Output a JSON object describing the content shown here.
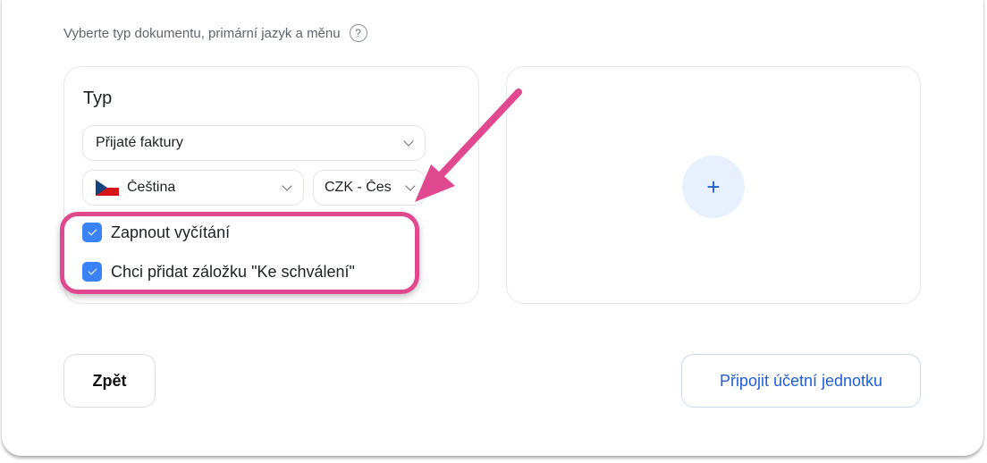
{
  "subtitle": "Vyberte typ dokumentu, primární jazyk a měnu",
  "help_icon": "?",
  "left_card": {
    "title": "Typ",
    "document_type": {
      "value": "Přijaté faktury",
      "icon": "chevron-down-icon"
    },
    "language": {
      "value": "Čeština",
      "flag": "czech-flag-icon"
    },
    "currency": {
      "value": "CZK - Čes"
    },
    "checkboxes": [
      {
        "label": "Zapnout vyčítání",
        "checked": true
      },
      {
        "label": "Chci přidat záložku \"Ke schválení\"",
        "checked": true
      }
    ]
  },
  "right_card": {
    "add_label": "+"
  },
  "buttons": {
    "back": "Zpět",
    "connect": "Připojit účetní jednotku"
  },
  "colors": {
    "accent": "#3b82f6",
    "link_blue": "#1f5fd6",
    "annotation_pink": "#e0498f"
  }
}
